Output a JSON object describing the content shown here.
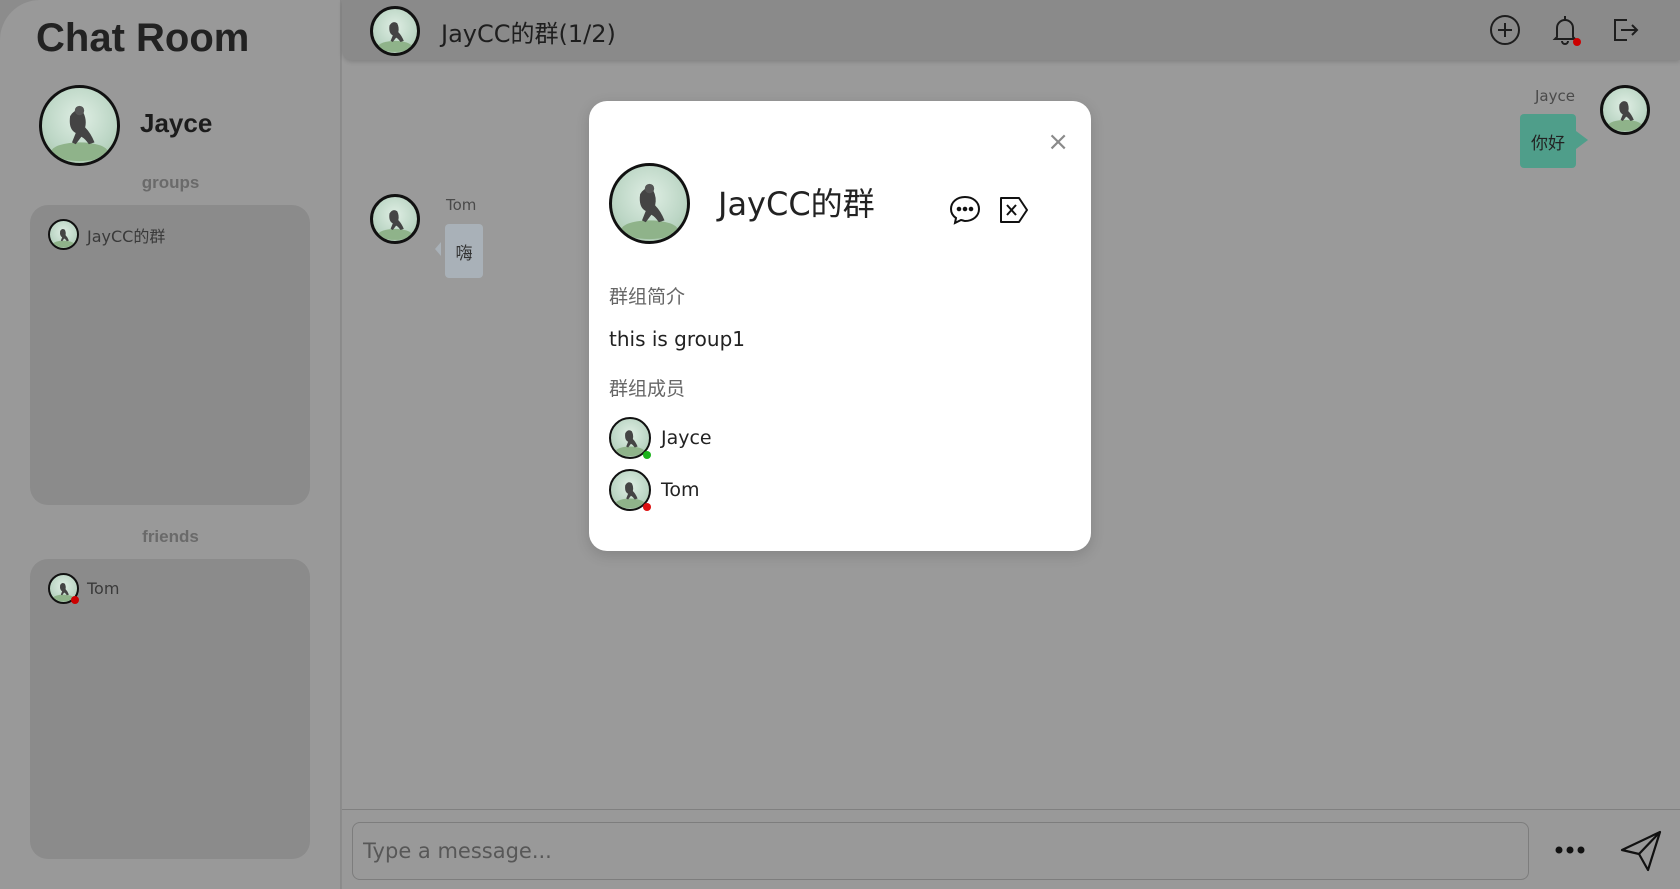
{
  "app": {
    "title": "Chat Room"
  },
  "user": {
    "name": "Jayce"
  },
  "sidebar": {
    "groups_label": "groups",
    "groups": [
      {
        "name": "JayCC的群"
      }
    ],
    "friends_label": "friends",
    "friends": [
      {
        "name": "Tom",
        "status_color": "#cc0000"
      }
    ]
  },
  "header": {
    "title": "JayCC的群(1/2)",
    "icons": [
      "plus-circle-icon",
      "bell-icon",
      "logout-icon"
    ]
  },
  "messages": [
    {
      "sender": "Jayce",
      "text": "你好",
      "side": "right"
    },
    {
      "sender": "Tom",
      "text": "嗨",
      "side": "left"
    }
  ],
  "composer": {
    "placeholder": "Type a message..."
  },
  "modal": {
    "title": "JayCC的群",
    "desc_label": "群组简介",
    "desc": "this is group1",
    "members_label": "群组成员",
    "members": [
      {
        "name": "Jayce",
        "status_color": "#1bb31b"
      },
      {
        "name": "Tom",
        "status_color": "#dd1111"
      }
    ]
  },
  "colors": {
    "accent": "#4f9e8a",
    "online": "#1bb31b",
    "offline": "#dd1111"
  }
}
